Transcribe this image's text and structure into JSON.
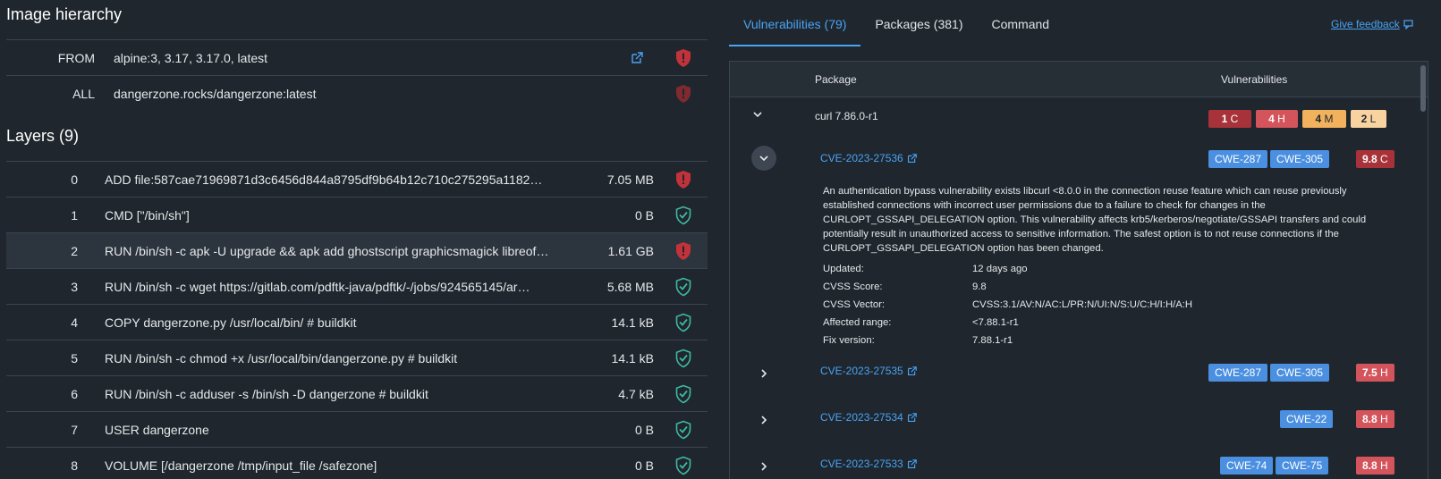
{
  "left": {
    "hierarchy_title": "Image hierarchy",
    "hierarchy": [
      {
        "kind": "FROM",
        "value": "alpine:3, 3.17, 3.17.0, latest",
        "status": "vulnerable"
      },
      {
        "kind": "ALL",
        "value": "dangerzone.rocks/dangerzone:latest",
        "status": "vulnerable"
      }
    ],
    "layers_title": "Layers (9)",
    "layers": [
      {
        "idx": "0",
        "cmd": "ADD file:587cae71969871d3c6456d844a8795df9b64b12c710c275295a1182…",
        "size": "7.05 MB",
        "status": "vulnerable"
      },
      {
        "idx": "1",
        "cmd": "CMD [\"/bin/sh\"]",
        "size": "0 B",
        "status": "ok"
      },
      {
        "idx": "2",
        "cmd": "RUN /bin/sh -c apk -U upgrade && apk add ghostscript graphicsmagick libreof…",
        "size": "1.61 GB",
        "status": "vulnerable"
      },
      {
        "idx": "3",
        "cmd": "RUN /bin/sh -c wget https://gitlab.com/pdftk-java/pdftk/-/jobs/924565145/ar…",
        "size": "5.68 MB",
        "status": "ok"
      },
      {
        "idx": "4",
        "cmd": "COPY dangerzone.py /usr/local/bin/ # buildkit",
        "size": "14.1 kB",
        "status": "ok"
      },
      {
        "idx": "5",
        "cmd": "RUN /bin/sh -c chmod +x /usr/local/bin/dangerzone.py # buildkit",
        "size": "14.1 kB",
        "status": "ok"
      },
      {
        "idx": "6",
        "cmd": "RUN /bin/sh -c adduser -s /bin/sh -D dangerzone # buildkit",
        "size": "4.7 kB",
        "status": "ok"
      },
      {
        "idx": "7",
        "cmd": "USER dangerzone",
        "size": "0 B",
        "status": "ok"
      },
      {
        "idx": "8",
        "cmd": "VOLUME [/dangerzone /tmp/input_file /safezone]",
        "size": "0 B",
        "status": "ok"
      }
    ]
  },
  "right": {
    "tabs": [
      "Vulnerabilities (79)",
      "Packages (381)",
      "Command"
    ],
    "feedback": "Give feedback",
    "col_package": "Package",
    "col_vulns": "Vulnerabilities",
    "package": {
      "name": "curl 7.86.0-r1",
      "critical_count": "1",
      "critical_letter": "C",
      "high_count": "4",
      "high_letter": "H",
      "medium_count": "4",
      "medium_letter": "M",
      "low_count": "2",
      "low_letter": "L"
    },
    "cves": [
      {
        "id": "CVE-2023-27536",
        "cwes": [
          "CWE-287",
          "CWE-305"
        ],
        "score": "9.8",
        "sev": "C"
      },
      {
        "id": "CVE-2023-27535",
        "cwes": [
          "CWE-287",
          "CWE-305"
        ],
        "score": "7.5",
        "sev": "H"
      },
      {
        "id": "CVE-2023-27534",
        "cwes": [
          "CWE-22"
        ],
        "score": "8.8",
        "sev": "H"
      },
      {
        "id": "CVE-2023-27533",
        "cwes": [
          "CWE-74",
          "CWE-75"
        ],
        "score": "8.8",
        "sev": "H"
      }
    ],
    "detail": {
      "description": "An authentication bypass vulnerability exists libcurl <8.0.0 in the connection reuse feature which can reuse previously established connections with incorrect user permissions due to a failure to check for changes in the CURLOPT_GSSAPI_DELEGATION option. This vulnerability affects krb5/kerberos/negotiate/GSSAPI transfers and could potentially result in unauthorized access to sensitive information. The safest option is to not reuse connections if the CURLOPT_GSSAPI_DELEGATION option has been changed.",
      "updated_label": "Updated:",
      "updated": "12 days ago",
      "score_label": "CVSS Score:",
      "score": "9.8",
      "vector_label": "CVSS Vector:",
      "vector": "CVSS:3.1/AV:N/AC:L/PR:N/UI:N/S:U/C:H/I:H/A:H",
      "range_label": "Affected range:",
      "range": "<7.88.1-r1",
      "fix_label": "Fix version:",
      "fix": "7.88.1-r1"
    }
  },
  "colors": {
    "critical": "#a8323a",
    "high": "#d4545c",
    "medium": "#f2b15c",
    "low": "#f8d3a0",
    "accent": "#4aa3f5",
    "ok": "#3fb8a0"
  }
}
